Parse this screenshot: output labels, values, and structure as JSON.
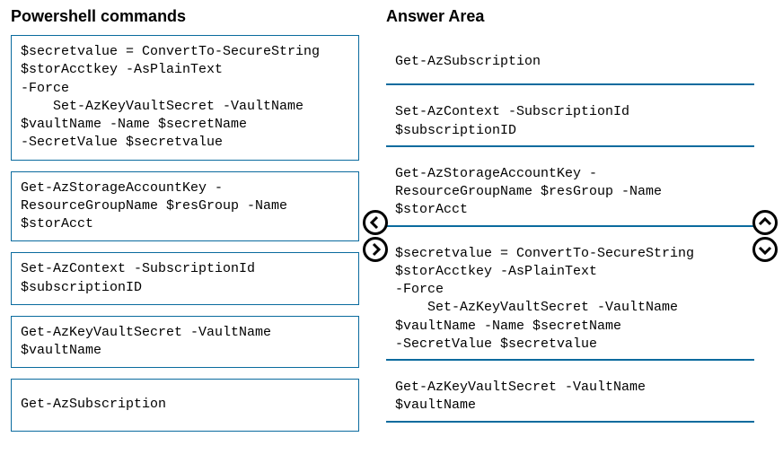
{
  "left": {
    "title": "Powershell commands",
    "items": [
      "$secretvalue = ConvertTo-SecureString\n$storAcctkey -AsPlainText\n-Force\n    Set-AzKeyVaultSecret -VaultName\n$vaultName -Name $secretName\n-SecretValue $secretvalue",
      "Get-AzStorageAccountKey -\nResourceGroupName $resGroup -Name\n$storAcct",
      "Set-AzContext -SubscriptionId\n$subscriptionID",
      "Get-AzKeyVaultSecret -VaultName\n$vaultName",
      "Get-AzSubscription"
    ]
  },
  "right": {
    "title": "Answer Area",
    "items": [
      "Get-AzSubscription",
      "Set-AzContext -SubscriptionId\n$subscriptionID",
      "Get-AzStorageAccountKey -\nResourceGroupName $resGroup -Name\n$storAcct",
      "$secretvalue = ConvertTo-SecureString\n$storAcctkey -AsPlainText\n-Force\n    Set-AzKeyVaultSecret -VaultName\n$vaultName -Name $secretName\n-SecretValue $secretvalue",
      "Get-AzKeyVaultSecret -VaultName\n$vaultName"
    ]
  }
}
